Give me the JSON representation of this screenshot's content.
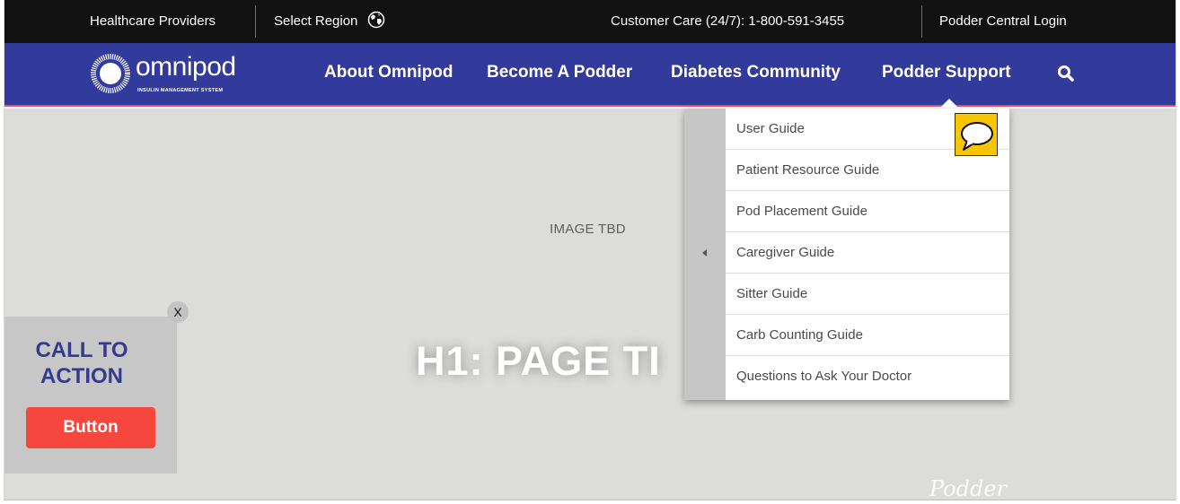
{
  "utility_bar": {
    "healthcare_providers": "Healthcare Providers",
    "select_region": "Select Region",
    "customer_care": "Customer Care (24/7):  1-800-591-3455",
    "login": "Podder Central Login"
  },
  "nav": {
    "logo_word": "omnipod",
    "logo_tagline": "INSULIN MANAGEMENT SYSTEM",
    "items": [
      {
        "label": "About Omnipod"
      },
      {
        "label": "Become A Podder"
      },
      {
        "label": "Diabetes Community"
      },
      {
        "label": "Podder Support"
      }
    ]
  },
  "dropdown": {
    "items": [
      {
        "label": "User Guide"
      },
      {
        "label": "Patient Resource Guide"
      },
      {
        "label": "Pod Placement Guide"
      },
      {
        "label": "Caregiver Guide"
      },
      {
        "label": "Sitter Guide"
      },
      {
        "label": "Carb Counting Guide"
      },
      {
        "label": "Questions to Ask Your Doctor"
      }
    ]
  },
  "hero": {
    "image_placeholder": "IMAGE TBD",
    "title": "H1: PAGE TI",
    "script_logo": "Podder"
  },
  "cta": {
    "close": "X",
    "title_line1": "CALL TO",
    "title_line2": "ACTION",
    "button": "Button"
  },
  "colors": {
    "utility_bg": "#111111",
    "nav_bg": "#323a9b",
    "nav_border": "#e2555a",
    "hero_bg": "#dcdcda",
    "cta_bg": "#c7c7c7",
    "cta_title": "#333a8f",
    "cta_button": "#f5473d",
    "chat_icon": "#f7c600"
  },
  "icons": [
    "globe-icon",
    "search-icon",
    "omnipod-logo-icon",
    "chat-bubble-icon",
    "chevron-left-icon"
  ]
}
